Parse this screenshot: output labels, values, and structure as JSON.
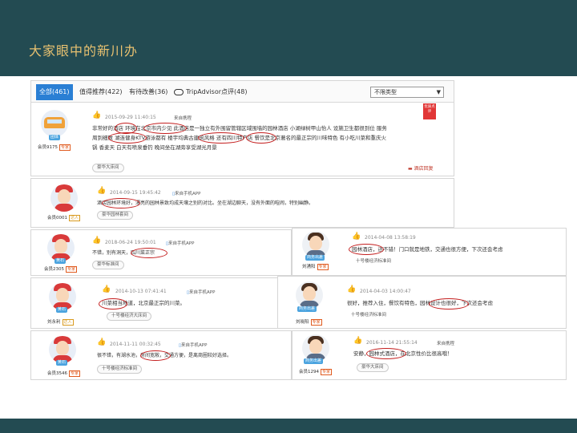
{
  "slide": {
    "title": "大家眼中的新川办"
  },
  "tabs": [
    {
      "label": "全部(461)",
      "active": true
    },
    {
      "label": "值得推荐(422)"
    },
    {
      "label": "有待改善(36)"
    },
    {
      "label": "TripAdvisor点评(48)"
    }
  ],
  "filter": {
    "selected": "不限类型"
  },
  "colors": {
    "accent": "#2a7fd4",
    "circle": "#c41e1e",
    "slide_bg": "#234b52"
  },
  "reviews": [
    {
      "member": "会员9175",
      "badge": "团体",
      "level_tag": "专家",
      "timestamp": "2015-09-29 11:40:15",
      "source": "来自携程",
      "text_lines": [
        "非常好的酒店 环境在北京市内少见 此酒店是一独立有外围留管辖区域围墙的园林酒店 小湖绿树甲山怡人 设施卫生都很到位 服务",
        "周到细致 湖连健身KTV游泳都有 楼宇均典古建筑风格 还有四川特产店 餐饮是北京著名的最正宗的川味特色 有小吃川菜和重庆火",
        "锅 香麦天 白天有喷泉垂钓 晚间坐在湖旁享受湖光月景"
      ],
      "room": "豪华大床间",
      "report": "酒店回复",
      "ribbon": "优质点评"
    },
    {
      "member": "会员0001",
      "badge": "",
      "level_tag": "达人",
      "timestamp": "2014-09-15 19:45:42",
      "source": "来自手机APP",
      "text_lines": [
        "酒店园林环境好，漂亮的园林景致均成天壤之别的对比。坐在湖边聊天，没有外面的喧闹，特别幽静。"
      ],
      "room": "豪华园林套间"
    },
    {
      "member": "会员2305",
      "badge": "黄石",
      "level_tag": "专家",
      "timestamp": "2018-06-24 19:50:01",
      "source": "来自手机APP",
      "text_lines": [
        "不错，别有洞天，四川菜正宗"
      ],
      "room": "豪华标准间"
    },
    {
      "member": "刘湧阳",
      "badge": "商务出差",
      "level_tag": "专家",
      "timestamp": "2014-04-08 13:58:19",
      "source": "",
      "text_lines": [
        "园林酒店，还不错！门口就是地铁，交通也很方便，下次还会考虑"
      ],
      "room": "十号楼经济标准间"
    },
    {
      "member": "刘永利",
      "badge": "黄石",
      "level_tag": "达人",
      "timestamp": "2014-10-13 07:41:41",
      "source": "来自手机APP",
      "text_lines": [
        "川菜相当地道，北京最正宗的川菜。"
      ],
      "room": "十号楼经济大床间"
    },
    {
      "member": "刘晓阳",
      "badge": "商务出差",
      "level_tag": "专家",
      "timestamp": "2014-04-03 14:00:47",
      "source": "",
      "text_lines": [
        "很好，推荐入住，餐饮有特色，园林设计也很好，下次还会考虑"
      ],
      "room": "十号楼经济标准间"
    },
    {
      "member": "会员3546",
      "badge": "黄石",
      "level_tag": "专家",
      "timestamp": "2014-11-11 00:32:45",
      "source": "来自手机APP",
      "text_lines": [
        "很不错，有湖水池，房间宽敞，交通方便，是离商圈较好选择。"
      ],
      "room": "十号楼经济标准间"
    },
    {
      "member": "会员1294",
      "badge": "商务出差",
      "level_tag": "专家",
      "timestamp": "2016-11-14 21:55:14",
      "source": "来自携程",
      "text_lines": [
        "安静，园林式酒店，在北京性价比很高哦！"
      ],
      "room": "豪华大床间"
    }
  ]
}
